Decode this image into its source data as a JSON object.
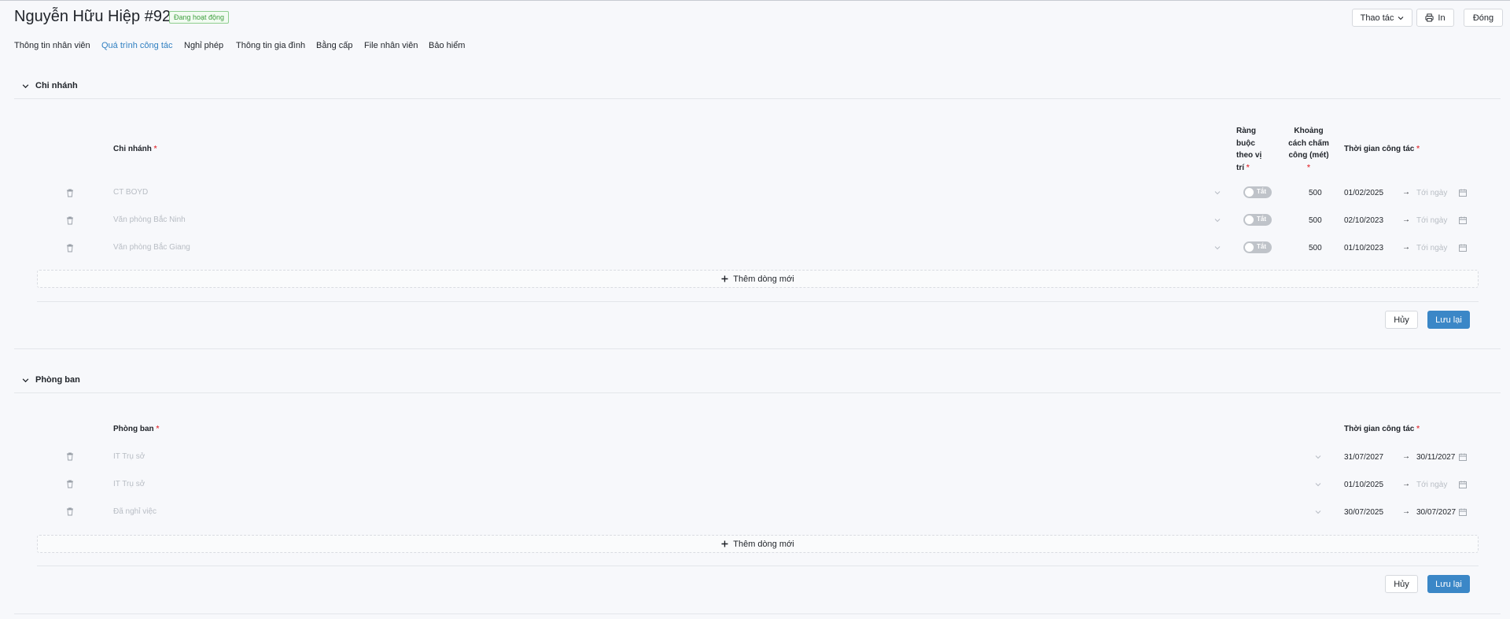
{
  "header": {
    "title": "Nguyễn Hữu Hiệp #92",
    "status": "Đang hoạt động",
    "actions_label": "Thao tác",
    "print_label": "In",
    "close_label": "Đóng"
  },
  "tabs": [
    {
      "label": "Thông tin nhân viên"
    },
    {
      "label": "Quá trình công tác"
    },
    {
      "label": "Nghỉ phép"
    },
    {
      "label": "Thông tin gia đình"
    },
    {
      "label": "Bằng cấp"
    },
    {
      "label": "File nhân viên"
    },
    {
      "label": "Bảo hiểm"
    }
  ],
  "branch": {
    "title": "Chi nhánh",
    "col_branch": "Chi nhánh",
    "col_constraint": "Ràng buộc theo vị trí",
    "col_distance": "Khoảng cách chấm công (mét)",
    "col_time": "Thời gian công tác",
    "rows": [
      {
        "name": "CT BOYD",
        "toggle": "Tắt",
        "distance": "500",
        "from": "01/02/2025",
        "to": "Tới ngày"
      },
      {
        "name": "Văn phòng Bắc Ninh",
        "toggle": "Tắt",
        "distance": "500",
        "from": "02/10/2023",
        "to": "Tới ngày"
      },
      {
        "name": "Văn phòng Bắc Giang",
        "toggle": "Tắt",
        "distance": "500",
        "from": "01/10/2023",
        "to": "Tới ngày"
      }
    ],
    "add_label": "Thêm dòng mới",
    "cancel_label": "Hủy",
    "save_label": "Lưu lại"
  },
  "department": {
    "title": "Phòng ban",
    "col_department": "Phòng ban",
    "col_time": "Thời gian công tác",
    "rows": [
      {
        "name": "IT Trụ sở",
        "from": "31/07/2027",
        "to": "30/11/2027"
      },
      {
        "name": "IT Trụ sở",
        "from": "01/10/2025",
        "to": "Tới ngày"
      },
      {
        "name": "Đã nghỉ việc",
        "from": "30/07/2025",
        "to": "30/07/2027"
      }
    ],
    "add_label": "Thêm dòng mới",
    "cancel_label": "Hủy",
    "save_label": "Lưu lại"
  },
  "colors": {
    "accent": "#3b87c7",
    "tab_active": "#2f7fc1",
    "status_green": "#3f9f3f",
    "required": "#e5484d"
  }
}
